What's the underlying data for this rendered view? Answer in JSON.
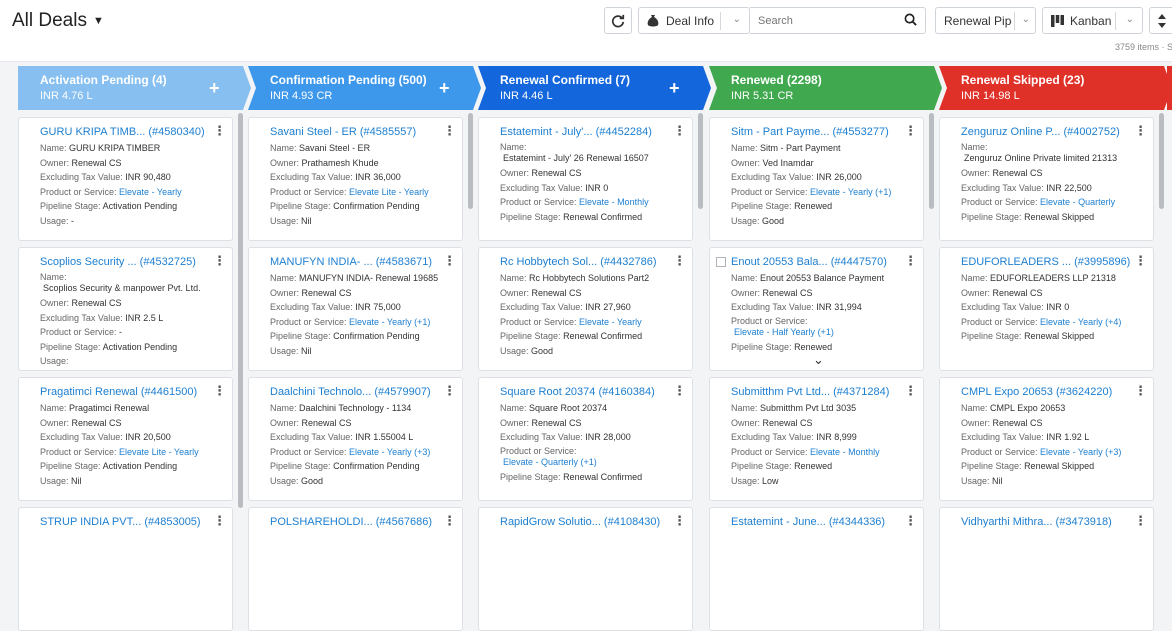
{
  "header": {
    "title": "All Deals",
    "deal_info_label": "Deal Info",
    "search_placeholder": "Search",
    "pipeline_label": "Renewal Pipeline",
    "view_label": "Kanban",
    "items_count": "3759 items · S"
  },
  "icons": {
    "refresh": "refresh-icon",
    "money_bag": "money-bag-icon",
    "search": "search-icon",
    "kanban": "kanban-icon",
    "sort": "sort-icon",
    "plus": "plus-icon",
    "kebab": "kebab-menu-icon"
  },
  "colors": {
    "activation": "#86bff0",
    "confirmation": "#3d97eb",
    "renewal_confirmed": "#1366db",
    "renewed": "#40a84f",
    "renewal_skipped": "#e03128",
    "link": "#1d7fd0"
  },
  "labels": {
    "name": "Name:",
    "owner": "Owner:",
    "tax": "Excluding Tax Value:",
    "product": "Product or Service:",
    "pipeline": "Pipeline Stage:",
    "usage": "Usage:"
  },
  "stages": [
    {
      "name": "Activation Pending (4)",
      "amount": "INR 4.76 L",
      "cards": [
        {
          "title": "GURU KRIPA TIMB... (#4580340)",
          "name": "GURU KRIPA TIMBER",
          "owner": "Renewal CS",
          "tax": "INR 90,480",
          "product": "Elevate - Yearly",
          "stage": "Activation Pending",
          "usage": "-"
        },
        {
          "title": "Scoplios Security ... (#4532725)",
          "name": "Scoplios Security & manpower Pvt. Ltd.",
          "owner": "Renewal CS",
          "tax": "INR 2.5 L",
          "product": "-",
          "stage": "Activation Pending",
          "usage": ""
        },
        {
          "title": "Pragatimci Renewal (#4461500)",
          "name": "Pragatimci Renewal",
          "owner": "Renewal CS",
          "tax": "INR 20,500",
          "product": "Elevate Lite - Yearly",
          "stage": "Activation Pending",
          "usage": "Nil"
        },
        {
          "title": "STRUP INDIA PVT... (#4853005)"
        }
      ]
    },
    {
      "name": "Confirmation Pending (500)",
      "amount": "INR 4.93 CR",
      "cards": [
        {
          "title": "Savani Steel - ER (#4585557)",
          "name": "Savani Steel - ER",
          "owner": "Prathamesh Khude",
          "tax": "INR 36,000",
          "product": "Elevate Lite - Yearly",
          "stage": "Confirmation Pending",
          "usage": "Nil"
        },
        {
          "title": "MANUFYN INDIA- ... (#4583671)",
          "name": "MANUFYN INDIA- Renewal 19685",
          "owner": "Renewal CS",
          "tax": "INR 75,000",
          "product": "Elevate - Yearly",
          "product_extra": "(+1)",
          "stage": "Confirmation Pending",
          "usage": "Nil"
        },
        {
          "title": "Daalchini Technolo... (#4579907)",
          "name": "Daalchini Technology - 1134",
          "owner": "Renewal CS",
          "tax": "INR 1.55004 L",
          "product": "Elevate - Yearly",
          "product_extra": "(+3)",
          "stage": "Confirmation Pending",
          "usage": "Good"
        },
        {
          "title": "POLSHAREHOLDI... (#4567686)"
        }
      ]
    },
    {
      "name": "Renewal Confirmed (7)",
      "amount": "INR 4.46 L",
      "cards": [
        {
          "title": "Estatemint - July'... (#4452284)",
          "name": "Estatemint - July' 26 Renewal 16507",
          "owner": "Renewal CS",
          "tax": "INR 0",
          "product": "Elevate - Monthly",
          "stage": "Renewal Confirmed"
        },
        {
          "title": "Rc Hobbytech Sol... (#4432786)",
          "name": "Rc Hobbytech Solutions Part2",
          "owner": "Renewal CS",
          "tax": "INR 27,960",
          "product": "Elevate - Yearly",
          "stage": "Renewal Confirmed",
          "usage": "Good"
        },
        {
          "title": "Square Root 20374 (#4160384)",
          "name": "Square Root 20374",
          "owner": "Renewal CS",
          "tax": "INR 28,000",
          "product": "Elevate - Quarterly",
          "product_extra": "(+1)",
          "stage": "Renewal Confirmed"
        },
        {
          "title": "RapidGrow Solutio... (#4108430)"
        }
      ]
    },
    {
      "name": "Renewed (2298)",
      "amount": "INR 5.31 CR",
      "cards": [
        {
          "title": "Sitm - Part Payme... (#4553277)",
          "name": "Sitm - Part Payment",
          "owner": "Ved Inamdar",
          "tax": "INR 26,000",
          "product": "Elevate - Yearly",
          "product_extra": "(+1)",
          "stage": "Renewed",
          "usage": "Good"
        },
        {
          "title": "Enout 20553 Bala... (#4447570)",
          "name": "Enout 20553 Balance Payment",
          "owner": "Renewal CS",
          "tax": "INR 31,994",
          "product": "Elevate - Half Yearly",
          "product_extra": "(+1)",
          "stage": "Renewed"
        },
        {
          "title": "Submitthm Pvt Ltd... (#4371284)",
          "name": "Submitthm Pvt Ltd 3035",
          "owner": "Renewal CS",
          "tax": "INR 8,999",
          "product": "Elevate - Monthly",
          "stage": "Renewed",
          "usage": "Low"
        },
        {
          "title": "Estatemint - June... (#4344336)"
        }
      ]
    },
    {
      "name": "Renewal Skipped (23)",
      "amount": "INR 14.98 L",
      "cards": [
        {
          "title": "Zenguruz Online P... (#4002752)",
          "name": "Zenguruz Online Private limited 21313",
          "owner": "Renewal CS",
          "tax": "INR 22,500",
          "product": "Elevate - Quarterly",
          "stage": "Renewal Skipped"
        },
        {
          "title": "EDUFORLEADERS ... (#3995896)",
          "name": "EDUFORLEADERS LLP 21318",
          "owner": "Renewal CS",
          "tax": "INR 0",
          "product": "Elevate - Yearly",
          "product_extra": "(+4)",
          "stage": "Renewal Skipped"
        },
        {
          "title": "CMPL Expo 20653 (#3624220)",
          "name": "CMPL Expo 20653",
          "owner": "Renewal CS",
          "tax": "INR 1.92 L",
          "product": "Elevate - Yearly",
          "product_extra": "(+3)",
          "stage": "Renewal Skipped",
          "usage": "Nil"
        },
        {
          "title": "Vidhyarthi Mithra... (#3473918)"
        }
      ]
    }
  ]
}
